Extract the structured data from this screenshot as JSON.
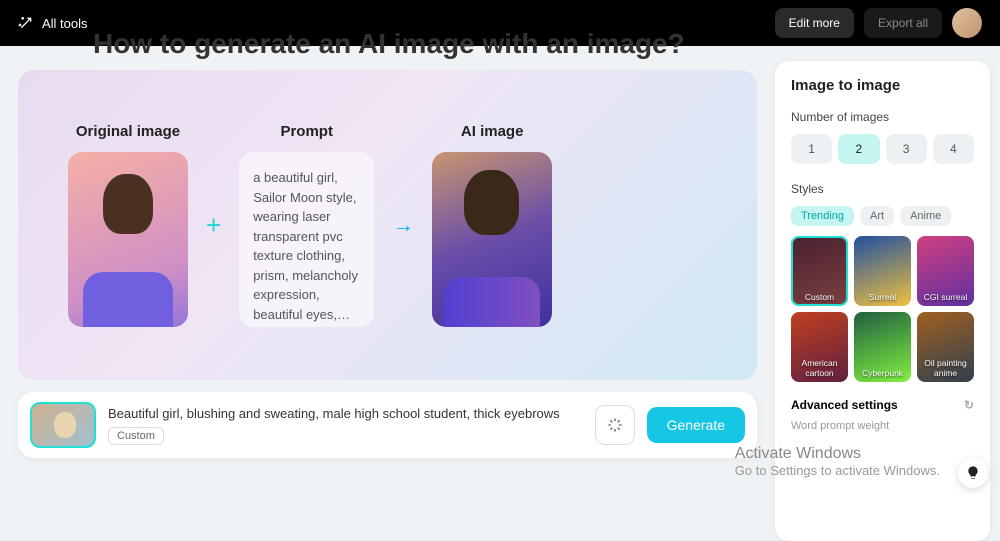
{
  "topbar": {
    "all_tools": "All tools",
    "edit_more": "Edit more",
    "export_all": "Export all"
  },
  "heading": "How to generate an AI image with an image?",
  "demo": {
    "original_label": "Original image",
    "prompt_label": "Prompt",
    "ai_label": "AI image",
    "prompt_text": "a beautiful girl, Sailor Moon style, wearing laser transparent pvc texture clothing, prism, melancholy expression, beautiful eyes,…"
  },
  "input": {
    "text": "Beautiful girl, blushing and sweating, male high school student, thick eyebrows",
    "chip": "Custom",
    "generate": "Generate"
  },
  "sidebar": {
    "title": "Image to image",
    "number_label": "Number of images",
    "numbers": [
      "1",
      "2",
      "3",
      "4"
    ],
    "selected_number_index": 1,
    "styles_label": "Styles",
    "style_tabs": [
      "Trending",
      "Art",
      "Anime"
    ],
    "selected_tab_index": 0,
    "style_cards": [
      "Custom",
      "Surreal",
      "CGI surreal",
      "American cartoon",
      "Cyberpunk",
      "Oil painting anime"
    ],
    "selected_style_index": 0,
    "advanced": "Advanced settings",
    "weight": "Word prompt weight"
  },
  "watermark": {
    "line1": "Activate Windows",
    "line2": "Go to Settings to activate Windows."
  }
}
